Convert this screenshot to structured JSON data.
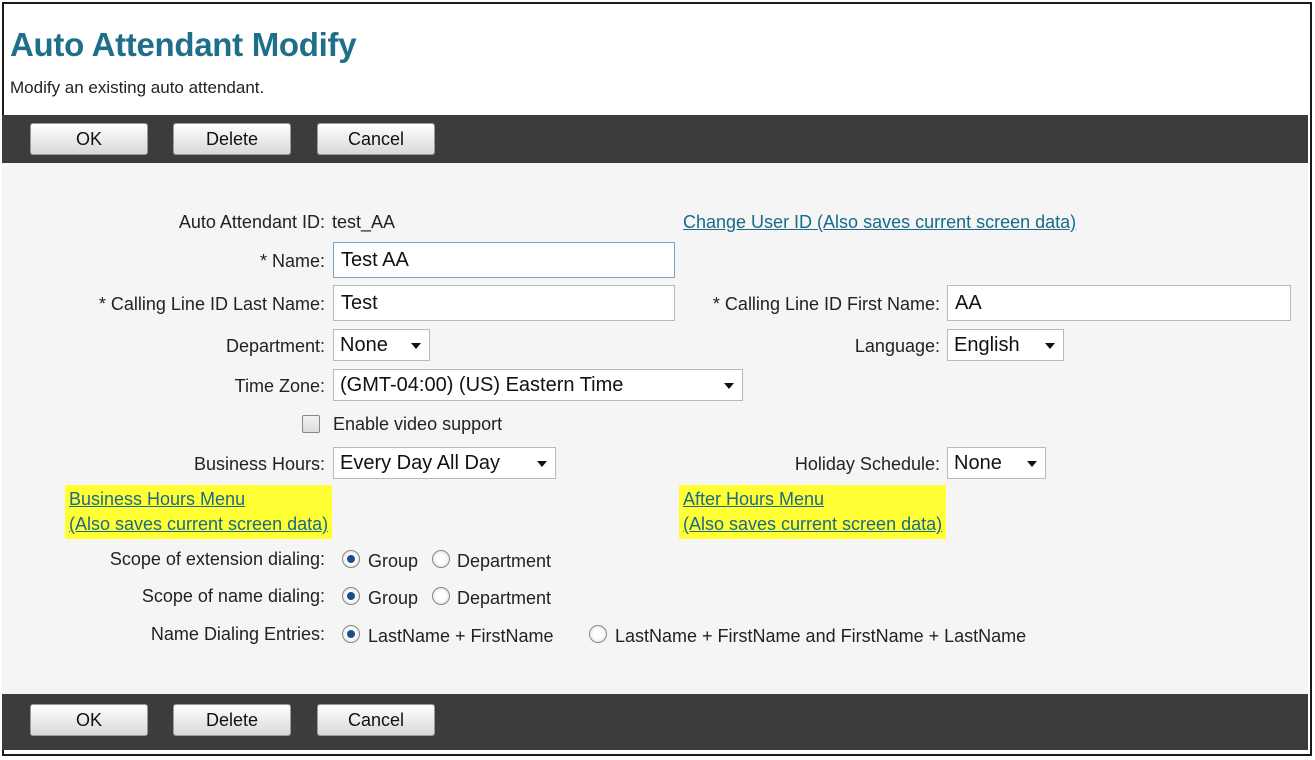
{
  "page": {
    "title": "Auto Attendant Modify",
    "description": "Modify an existing auto attendant."
  },
  "toolbar": {
    "ok_label": "OK",
    "delete_label": "Delete",
    "cancel_label": "Cancel"
  },
  "form": {
    "auto_attendant_id_label": "Auto Attendant ID:",
    "auto_attendant_id_value": "test_AA",
    "change_user_id_link": "Change User ID (Also saves current screen data)",
    "name_label": "* Name:",
    "name_value": "Test AA",
    "clid_last_label": "* Calling Line ID Last Name:",
    "clid_last_value": "Test",
    "clid_first_label": "* Calling Line ID First Name:",
    "clid_first_value": "AA",
    "department_label": "Department:",
    "department_value": "None",
    "language_label": "Language:",
    "language_value": "English",
    "timezone_label": "Time Zone:",
    "timezone_value": "(GMT-04:00) (US) Eastern Time",
    "video_label": "Enable video support",
    "video_checked": false,
    "business_hours_label": "Business Hours:",
    "business_hours_value": "Every Day All Day",
    "holiday_label": "Holiday Schedule:",
    "holiday_value": "None",
    "business_menu_link_line1": "Business Hours Menu",
    "business_menu_link_line2": "(Also saves current screen data)",
    "after_menu_link_line1": "After Hours Menu",
    "after_menu_link_line2": "(Also saves current screen data)",
    "ext_scope_label": "Scope of extension dialing:",
    "name_scope_label": "Scope of name dialing:",
    "name_entries_label": "Name Dialing Entries:",
    "opt_group": "Group",
    "opt_department": "Department",
    "opt_last_first": "LastName + FirstName",
    "opt_both": "LastName + FirstName and FirstName + LastName"
  },
  "colors": {
    "title": "#1f6f8b",
    "toolbar": "#3c3c3c",
    "highlight": "#ffff33",
    "link": "#1a6a8a"
  }
}
